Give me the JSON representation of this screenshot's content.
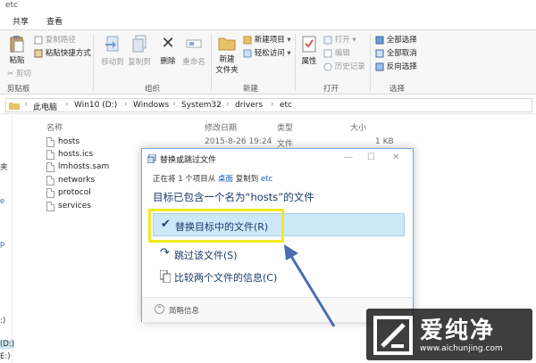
{
  "window": {
    "title": "etc"
  },
  "tabs": [
    {
      "label": "共享"
    },
    {
      "label": "查看"
    }
  ],
  "ribbon": {
    "clipboard": {
      "paste": "粘贴",
      "copy_path": "复制路径",
      "paste_shortcut": "粘贴快捷方式",
      "cut": "剪切",
      "label": "剪贴板"
    },
    "organize": {
      "move_to": "移动到",
      "copy_to": "复制到",
      "delete": "删除",
      "rename": "重命名",
      "label": "组织"
    },
    "new": {
      "new_folder": "新建\n文件夹",
      "new_folder_line1": "新建",
      "new_folder_line2": "文件夹",
      "new_item": "新建项目",
      "easy_access": "轻松访问",
      "label": "新建"
    },
    "open": {
      "properties": "属性",
      "open": "打开",
      "edit": "编辑",
      "history": "历史记录",
      "label": "打开"
    },
    "select": {
      "select_all": "全部选择",
      "select_none": "全部取消",
      "invert": "反向选择",
      "label": "选择"
    }
  },
  "address": {
    "crumbs": [
      "此电脑",
      "Win10 (D:)",
      "Windows",
      "System32",
      "drivers",
      "etc"
    ]
  },
  "nav": {
    "items": [
      "夹",
      "e",
      "p",
      ":)",
      "(D:)",
      "E:)"
    ]
  },
  "files": {
    "headers": {
      "name": "名称",
      "date": "修改日期",
      "type": "类型",
      "size": "大小"
    },
    "rows": [
      {
        "name": "hosts",
        "date": "2015-8-26 19:24",
        "type": "文件",
        "size": "1 KB"
      },
      {
        "name": "hosts.ics",
        "date": "",
        "type": "",
        "size": ""
      },
      {
        "name": "lmhosts.sam",
        "date": "",
        "type": "",
        "size": ""
      },
      {
        "name": "networks",
        "date": "",
        "type": "",
        "size": ""
      },
      {
        "name": "protocol",
        "date": "",
        "type": "",
        "size": ""
      },
      {
        "name": "services",
        "date": "",
        "type": "",
        "size": ""
      }
    ]
  },
  "dialog": {
    "title": "替换或跳过文件",
    "line1_prefix": "正在将 1 个项目从",
    "line1_src": "桌面",
    "line1_mid": "复制到",
    "line1_dst": "etc",
    "heading": "目标已包含一个名为“hosts”的文件",
    "option_replace": "替换目标中的文件(R)",
    "option_skip": "跳过该文件(S)",
    "option_compare": "比较两个文件的信息(C)",
    "details": "简略信息"
  },
  "watermark": {
    "brand": "爱纯净",
    "url": "www.aichunjing.com"
  },
  "colors": {
    "selected_option_bg": "#cde8f7",
    "highlight_box": "#f0ea1e",
    "arrow": "#4a6db3",
    "link_blue": "#1a5fb4"
  }
}
